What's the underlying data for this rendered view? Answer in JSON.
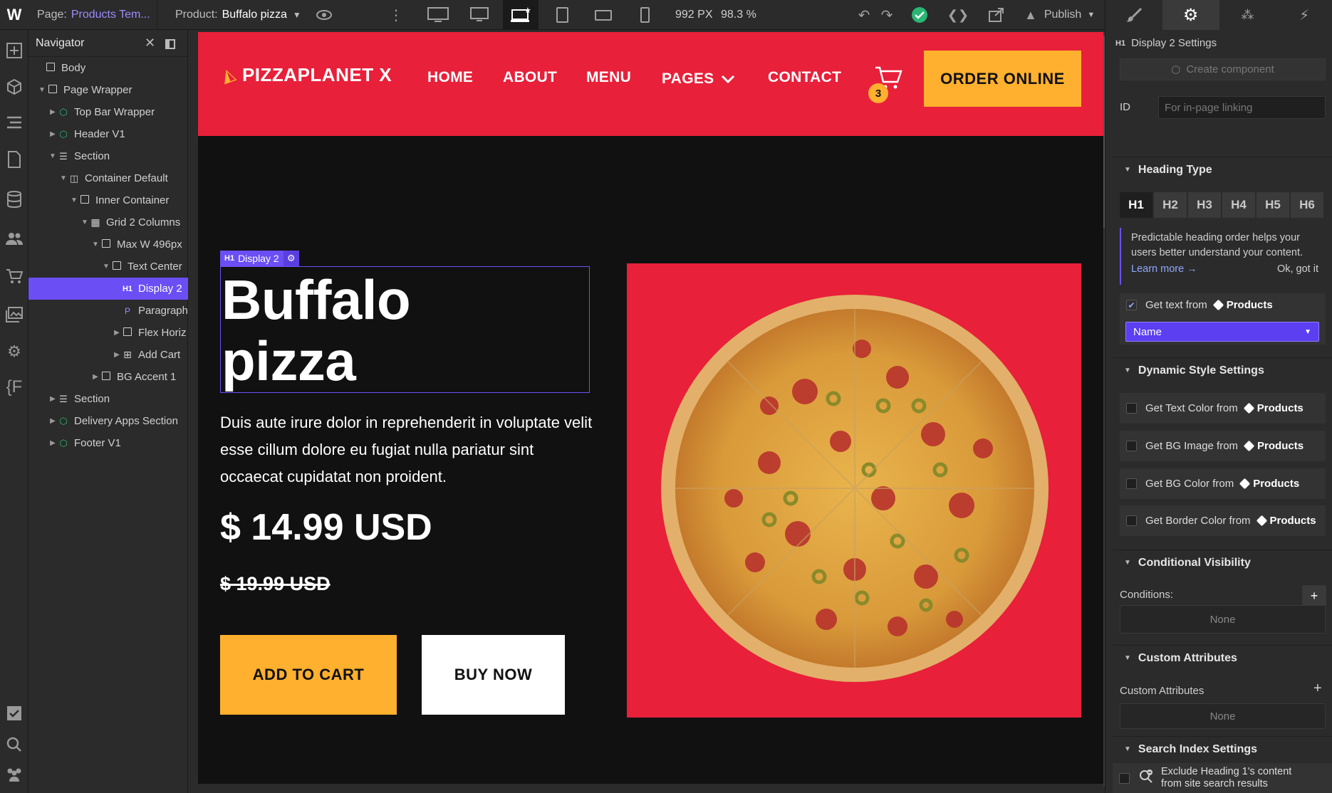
{
  "topbar": {
    "page_label": "Page:",
    "page_name": "Products Tem...",
    "product_label": "Product:",
    "product_name": "Buffalo pizza",
    "width_value": "992 PX",
    "zoom_value": "98.3 %",
    "publish_label": "Publish"
  },
  "navigator": {
    "title": "Navigator",
    "items": [
      {
        "label": "Body"
      },
      {
        "label": "Page Wrapper"
      },
      {
        "label": "Top Bar Wrapper"
      },
      {
        "label": "Header V1"
      },
      {
        "label": "Section"
      },
      {
        "label": "Container Default"
      },
      {
        "label": "Inner Container"
      },
      {
        "label": "Grid 2 Columns"
      },
      {
        "label": "Max W 496px"
      },
      {
        "label": "Text Center"
      },
      {
        "label": "Display 2",
        "tag": "H1"
      },
      {
        "label": "Paragraph",
        "tag": "P"
      },
      {
        "label": "Flex Horiz"
      },
      {
        "label": "Add Cart"
      },
      {
        "label": "BG Accent 1"
      },
      {
        "label": "Section"
      },
      {
        "label": "Delivery Apps Section"
      },
      {
        "label": "Footer V1"
      }
    ]
  },
  "site": {
    "logo": "PIZZAPLANET X",
    "nav": [
      "HOME",
      "ABOUT",
      "MENU",
      "PAGES",
      "CONTACT"
    ],
    "cart_count": "3",
    "order_button": "ORDER ONLINE",
    "element_tag": "H1",
    "element_label": "Display 2",
    "heading_line1": "Buffalo",
    "heading_line2": "pizza",
    "paragraph": "Duis aute irure dolor in reprehenderit in voluptate velit esse cillum dolore eu fugiat nulla pariatur sint occaecat cupidatat non proident.",
    "price": "$ 14.99 USD",
    "old_price": "$ 19.99 USD",
    "add_to_cart": "ADD TO CART",
    "buy_now": "BUY NOW"
  },
  "panel": {
    "settings_tag": "H1",
    "settings_title": "Display 2 Settings",
    "create_component": "Create component",
    "id_label": "ID",
    "id_placeholder": "For in-page linking",
    "heading_type_title": "Heading Type",
    "heading_levels": [
      "H1",
      "H2",
      "H3",
      "H4",
      "H5",
      "H6"
    ],
    "hint_text": "Predictable heading order helps your users better understand your content.",
    "learn_more": "Learn more →",
    "ok_got_it": "Ok, got it",
    "get_text_from": "Get text from",
    "products": "Products",
    "name_select": "Name",
    "dynamic_style_title": "Dynamic Style Settings",
    "dynamic_rows": [
      "Get Text Color from",
      "Get BG Image from",
      "Get BG Color from",
      "Get Border Color from"
    ],
    "conditional_title": "Conditional Visibility",
    "conditions_label": "Conditions:",
    "none_1": "None",
    "custom_attr_title": "Custom Attributes",
    "custom_attr_label": "Custom Attributes",
    "none_2": "None",
    "search_index_title": "Search Index Settings",
    "exclude_text": "Exclude Heading 1's content from site search results"
  },
  "colors": {
    "accent_purple": "#6c4ef5",
    "brand_red": "#e8203a",
    "brand_yellow": "#ffb02e",
    "publish_ok_green": "#2bb673"
  }
}
